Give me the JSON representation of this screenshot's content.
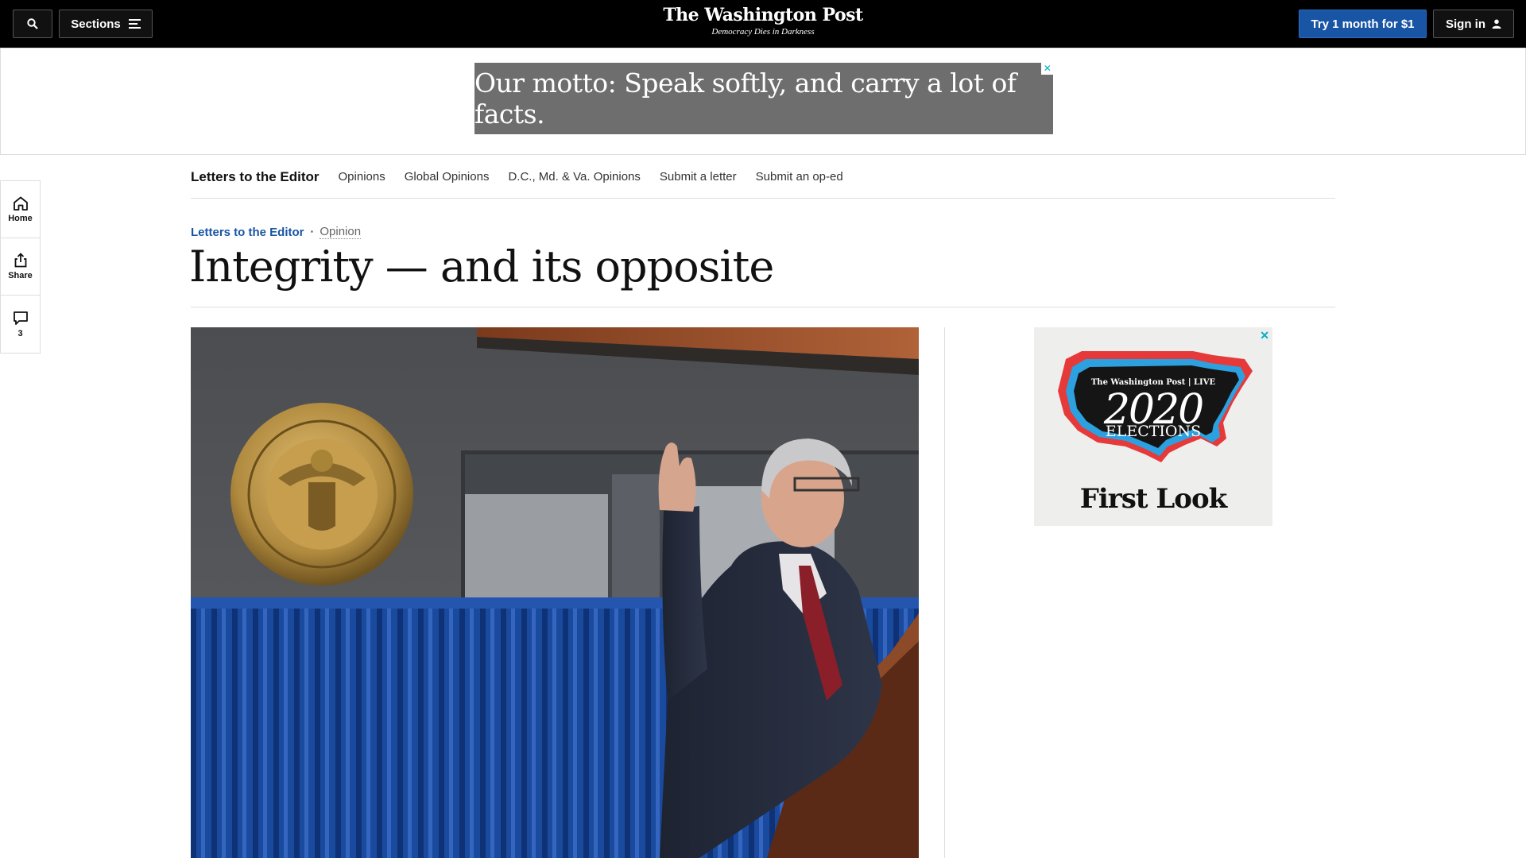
{
  "header": {
    "masthead_title": "The Washington Post",
    "masthead_tagline": "Democracy Dies in Darkness",
    "sections_label": "Sections",
    "try_label": "Try 1 month for $1",
    "signin_label": "Sign in"
  },
  "ad_banner": {
    "text": "Our motto: Speak softly, and carry a lot of facts.",
    "close_glyph": "✕"
  },
  "subnav": {
    "brand": "Letters to the Editor",
    "items": [
      "Opinions",
      "Global Opinions",
      "D.C., Md. & Va. Opinions",
      "Submit a letter",
      "Submit an op-ed"
    ]
  },
  "left_rail": {
    "home_label": "Home",
    "share_label": "Share",
    "comments_count": "3"
  },
  "article": {
    "kicker_section": "Letters to the Editor",
    "kicker_label": "Opinion",
    "headline": "Integrity — and its opposite"
  },
  "side_ad": {
    "brand": "The Washington Post | LIVE",
    "year": "2020",
    "elections": "ELECTIONS",
    "first_look": "First Look",
    "close_glyph": "✕"
  },
  "colors": {
    "accent_blue": "#1955a5",
    "topbar_bg": "#000000",
    "curtain_blue": "#1b4aa0"
  },
  "icons": [
    "search-icon",
    "menu-icon",
    "user-icon",
    "home-icon",
    "share-icon",
    "comment-icon",
    "close-icon"
  ]
}
